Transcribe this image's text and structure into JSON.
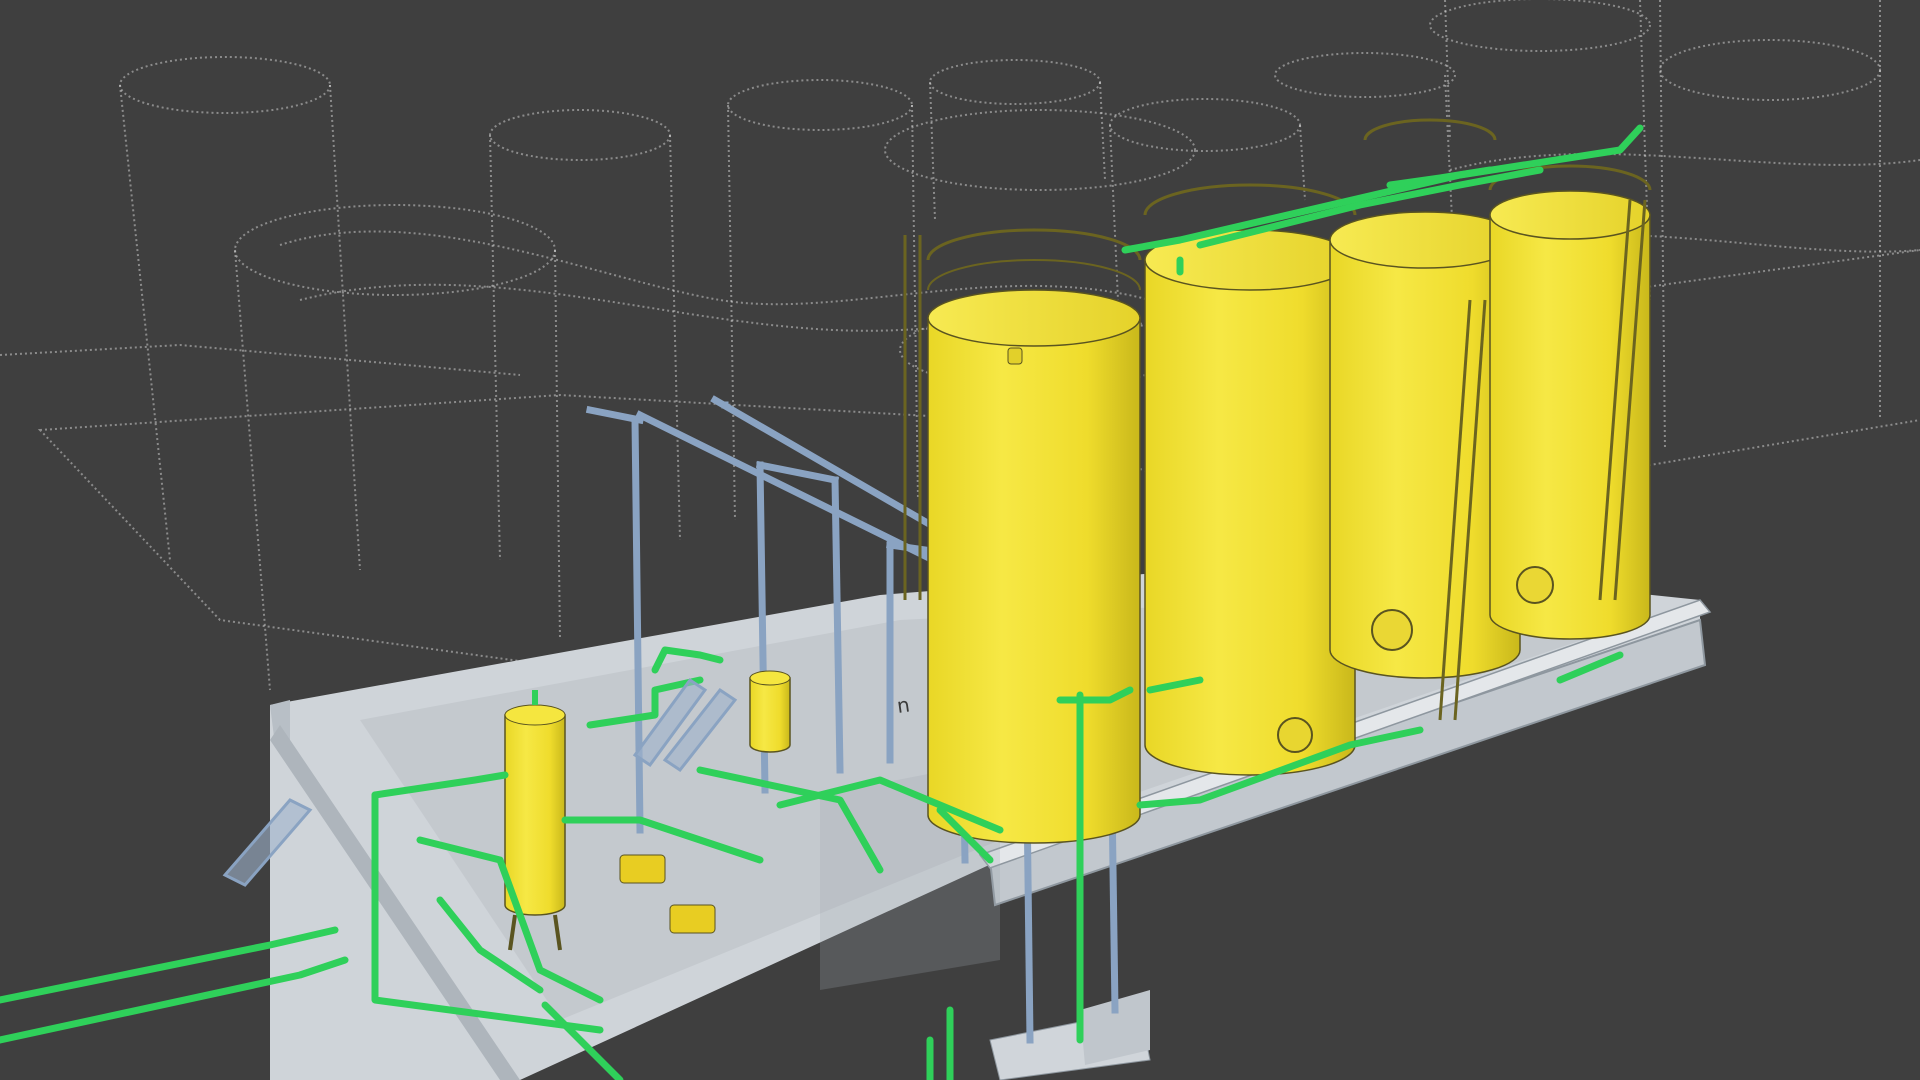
{
  "scene": {
    "label_text": "n",
    "colors": {
      "background": "#3f3f3f",
      "tank_yellow": "#f2e334",
      "tank_shadow": "#d4c21e",
      "pipe_green": "#2fd05a",
      "steel_blue": "#8aa3c2",
      "concrete": "#d6dade",
      "concrete_shadow": "#b8bfc6",
      "point_cloud": "#e8e8e8"
    }
  }
}
